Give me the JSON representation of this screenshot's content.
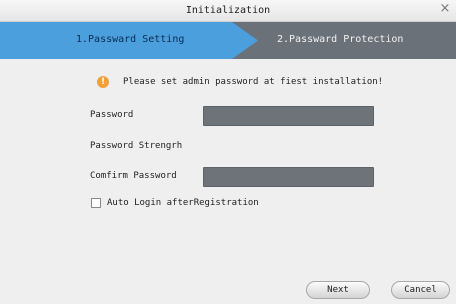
{
  "window": {
    "title": "Initialization",
    "close_glyph": "×"
  },
  "steps": {
    "items": [
      {
        "label": "1.Passward Setting",
        "active": true
      },
      {
        "label": "2.Passward Protection",
        "active": false
      }
    ],
    "active_color": "#4a9fdc",
    "inactive_color": "#6b7178"
  },
  "notice": {
    "icon": "warning-icon",
    "icon_glyph": "!",
    "text": "Please set admin password at fiest installation!"
  },
  "form": {
    "password_label": "Password",
    "strength_label": "Password Strengrh",
    "confirm_label": "Comfirm Password",
    "password_value": "",
    "confirm_value": ""
  },
  "auto_login": {
    "label": "Auto Login afterRegistration",
    "checked": false
  },
  "buttons": {
    "next": "Next",
    "cancel": "Cancel"
  }
}
